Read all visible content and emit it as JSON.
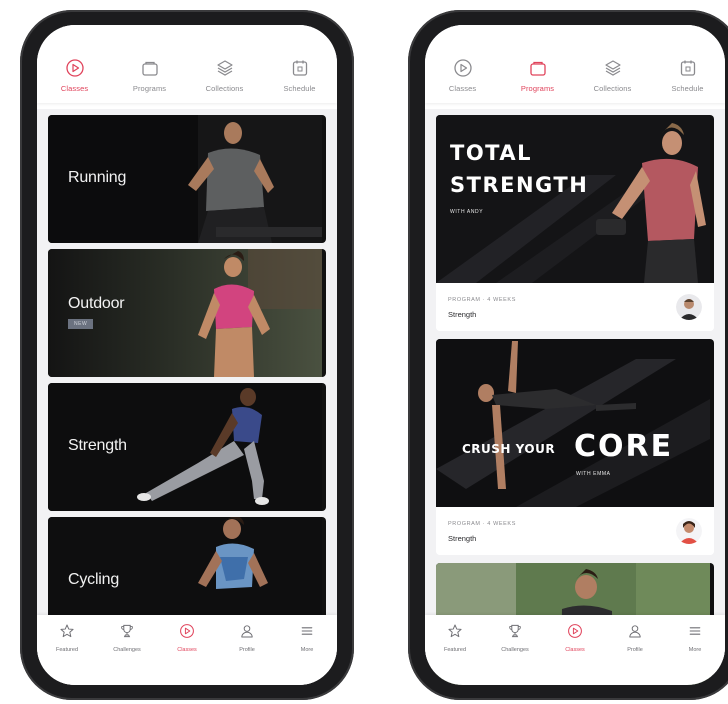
{
  "accent_color": "#e0435b",
  "left_phone": {
    "top_nav": [
      {
        "label": "Classes",
        "icon": "play-circle-icon",
        "active": true
      },
      {
        "label": "Programs",
        "icon": "program-folder-icon",
        "active": false
      },
      {
        "label": "Collections",
        "icon": "layers-icon",
        "active": false
      },
      {
        "label": "Schedule",
        "icon": "calendar-icon",
        "active": false
      }
    ],
    "categories": [
      {
        "label": "Running"
      },
      {
        "label": "Outdoor",
        "badge": "NEW"
      },
      {
        "label": "Strength"
      },
      {
        "label": "Cycling"
      }
    ],
    "bottom_nav": [
      {
        "label": "Featured",
        "icon": "star-icon",
        "active": false
      },
      {
        "label": "Challenges",
        "icon": "trophy-icon",
        "active": false
      },
      {
        "label": "Classes",
        "icon": "play-circle-icon",
        "active": true
      },
      {
        "label": "Profile",
        "icon": "person-icon",
        "active": false
      },
      {
        "label": "More",
        "icon": "menu-icon",
        "active": false
      }
    ]
  },
  "right_phone": {
    "top_nav": [
      {
        "label": "Classes",
        "icon": "play-circle-icon",
        "active": false
      },
      {
        "label": "Programs",
        "icon": "program-folder-icon",
        "active": true
      },
      {
        "label": "Collections",
        "icon": "layers-icon",
        "active": false
      },
      {
        "label": "Schedule",
        "icon": "calendar-icon",
        "active": false
      }
    ],
    "programs": [
      {
        "title_line1": "TOTAL",
        "title_line2": "STRENGTH",
        "subtitle": "WITH ANDY",
        "meta": "PROGRAM · 4 WEEKS",
        "type": "Strength"
      },
      {
        "title_line1": "CRUSH YOUR",
        "title_line2": "CORE",
        "subtitle": "WITH EMMA",
        "meta": "PROGRAM · 4 WEEKS",
        "type": "Strength"
      }
    ],
    "bottom_nav": [
      {
        "label": "Featured",
        "icon": "star-icon",
        "active": false
      },
      {
        "label": "Challenges",
        "icon": "trophy-icon",
        "active": false
      },
      {
        "label": "Classes",
        "icon": "play-circle-icon",
        "active": true
      },
      {
        "label": "Profile",
        "icon": "person-icon",
        "active": false
      },
      {
        "label": "More",
        "icon": "menu-icon",
        "active": false
      }
    ]
  }
}
